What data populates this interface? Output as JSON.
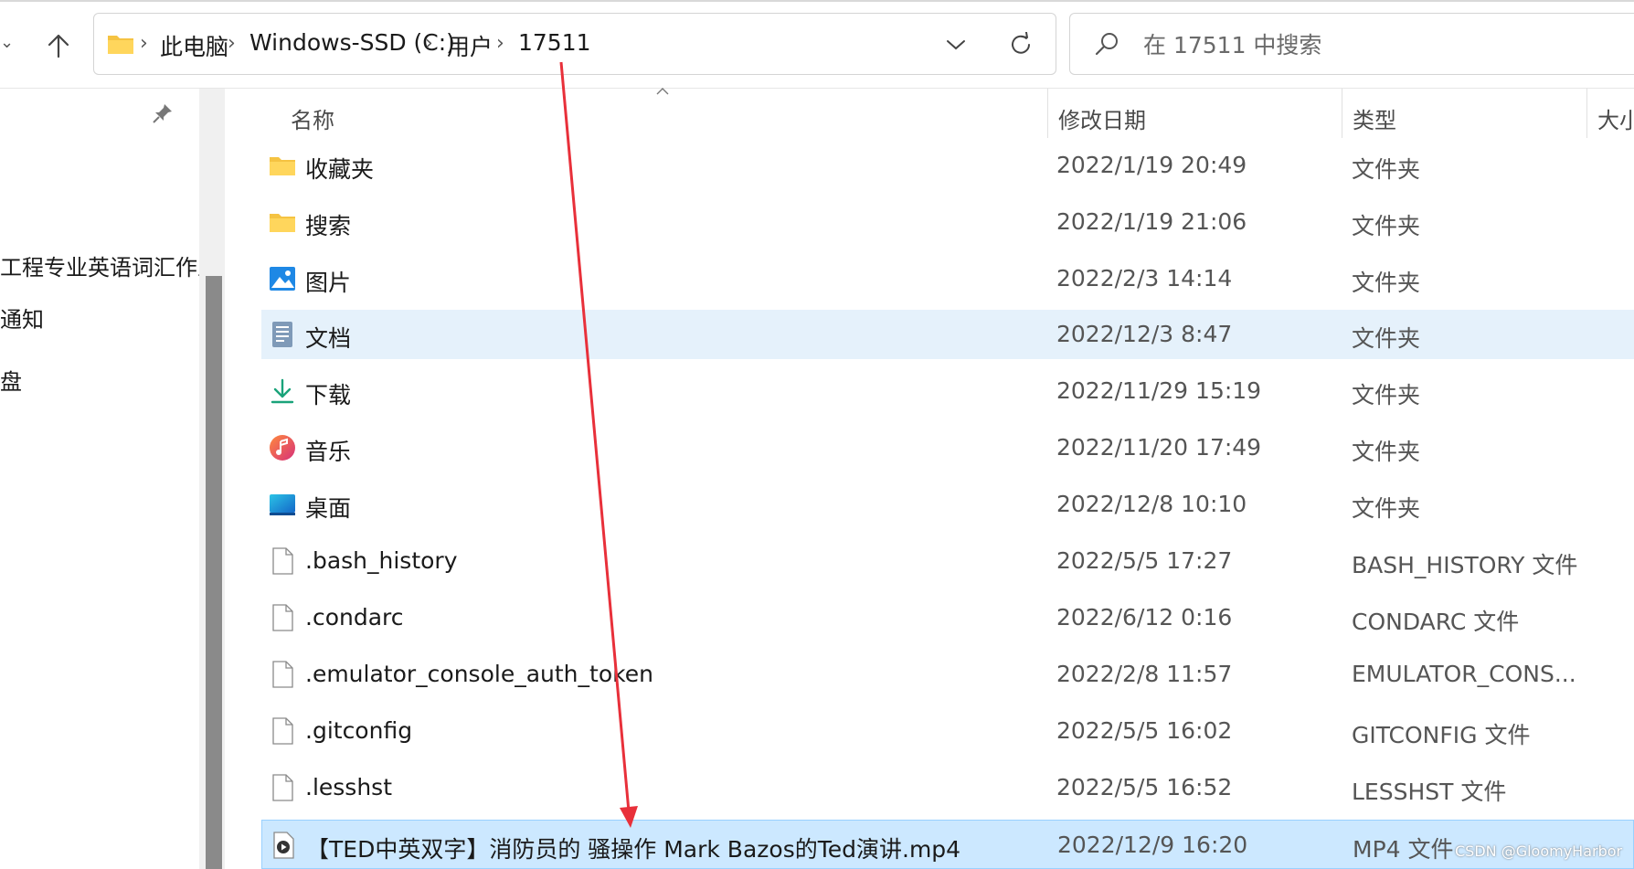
{
  "address_bar": {
    "crumbs": [
      "此电脑",
      "Windows-SSD (C:)",
      "用户",
      "17511"
    ]
  },
  "search": {
    "placeholder": "在 17511 中搜索"
  },
  "nav_pane": {
    "items": [
      "工程专业英语词汇作业",
      "通知",
      "盘"
    ]
  },
  "columns": {
    "name": "名称",
    "date": "修改日期",
    "type": "类型",
    "size": "大小"
  },
  "files": [
    {
      "name": "收藏夹",
      "date": "2022/1/19 20:49",
      "type": "文件夹",
      "icon": "folder-icon"
    },
    {
      "name": "搜索",
      "date": "2022/1/19 21:06",
      "type": "文件夹",
      "icon": "folder-icon"
    },
    {
      "name": "图片",
      "date": "2022/2/3 14:14",
      "type": "文件夹",
      "icon": "pictures-icon"
    },
    {
      "name": "文档",
      "date": "2022/12/3 8:47",
      "type": "文件夹",
      "icon": "documents-icon"
    },
    {
      "name": "下载",
      "date": "2022/11/29 15:19",
      "type": "文件夹",
      "icon": "download-icon"
    },
    {
      "name": "音乐",
      "date": "2022/11/20 17:49",
      "type": "文件夹",
      "icon": "music-icon"
    },
    {
      "name": "桌面",
      "date": "2022/12/8 10:10",
      "type": "文件夹",
      "icon": "desktop-icon"
    },
    {
      "name": ".bash_history",
      "date": "2022/5/5 17:27",
      "type": "BASH_HISTORY 文件",
      "icon": "file-icon"
    },
    {
      "name": ".condarc",
      "date": "2022/6/12 0:16",
      "type": "CONDARC 文件",
      "icon": "file-icon"
    },
    {
      "name": ".emulator_console_auth_token",
      "date": "2022/2/8 11:57",
      "type": "EMULATOR_CONS...",
      "icon": "file-icon"
    },
    {
      "name": ".gitconfig",
      "date": "2022/5/5 16:02",
      "type": "GITCONFIG 文件",
      "icon": "file-icon"
    },
    {
      "name": ".lesshst",
      "date": "2022/5/5 16:52",
      "type": "LESSHST 文件",
      "icon": "file-icon"
    },
    {
      "name": "【TED中英双字】消防员的 骚操作  Mark Bazos的Ted演讲.mp4",
      "date": "2022/12/9 16:20",
      "type": "MP4 文件",
      "icon": "video-file-icon"
    }
  ],
  "watermark": "CSDN @GloomyHarbor",
  "colors": {
    "hover_row": "#e5f1fb",
    "selected_row": "#cce8ff",
    "annotation_arrow": "#e8303a",
    "folder_yellow": "#f5c342"
  }
}
